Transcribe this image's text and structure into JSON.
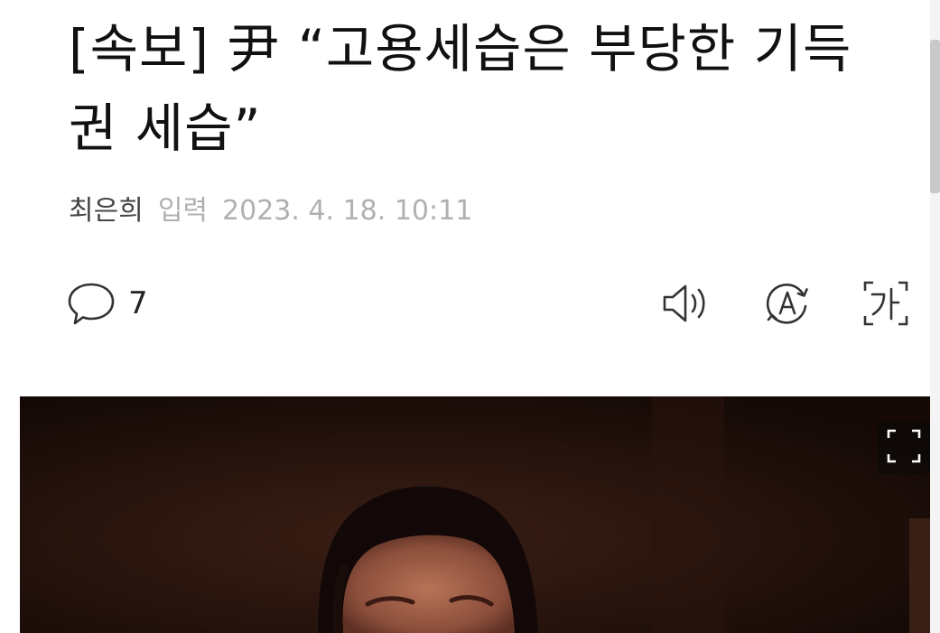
{
  "article": {
    "headline": "[속보] 尹 “고용세습은 부당한 기득권 세습”",
    "reporter": "최은희",
    "input_label": "입력",
    "timestamp": "2023. 4. 18. 10:11"
  },
  "toolbar": {
    "comment_count": "7",
    "icons": {
      "comment": "speech-bubble-icon",
      "speaker": "speaker-icon",
      "translate": "translate-icon",
      "font_size": "font-size-icon",
      "expand": "expand-icon"
    }
  },
  "colors": {
    "text": "#111111",
    "meta_muted": "#b0b0b0",
    "photo_background": "#1d0f0a"
  }
}
